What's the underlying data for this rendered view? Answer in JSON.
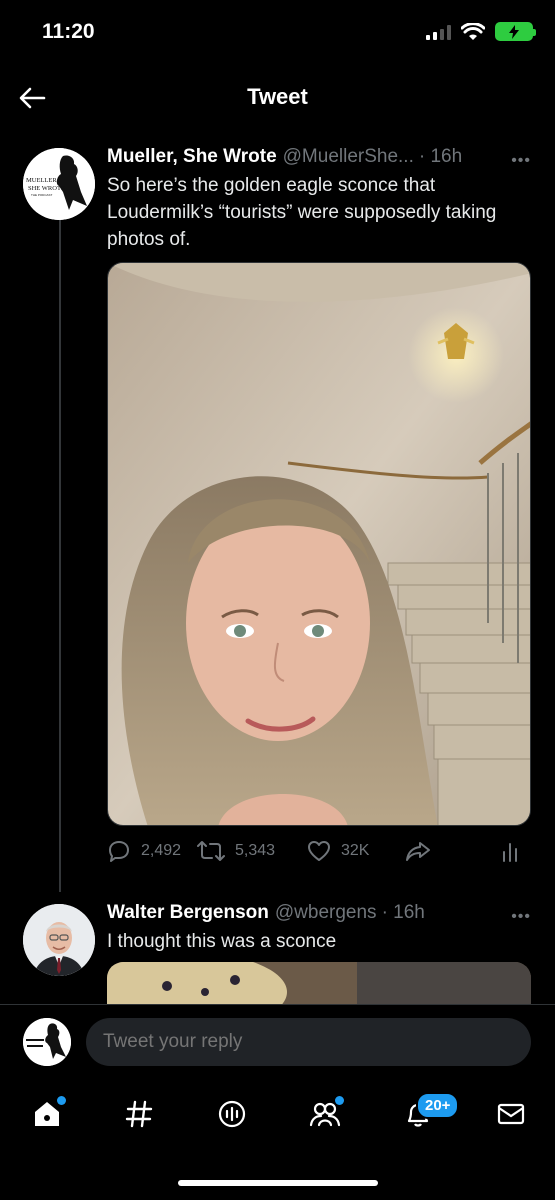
{
  "status": {
    "time": "11:20"
  },
  "header": {
    "title": "Tweet"
  },
  "tweet1": {
    "avatar_text": [
      "MUELLER,",
      "SHE WROTE",
      "THE PODCAST"
    ],
    "name": "Mueller, She Wrote",
    "handle": "@MuellerShe...",
    "time": "· 16h",
    "text": "So here’s the golden eagle sconce that Loudermilk’s “tourists” were supposedly taking photos of.",
    "replies": "2,492",
    "retweets": "5,343",
    "likes": "32K"
  },
  "tweet2": {
    "name": "Walter Bergenson",
    "handle": "@wbergens",
    "time": "· 16h",
    "text": "I thought this was a sconce"
  },
  "reply": {
    "placeholder": "Tweet your reply"
  },
  "tabs": {
    "notifications_badge": "20+"
  },
  "colors": {
    "accent": "#1d9bf0",
    "background": "#000000",
    "muted": "#71767b"
  }
}
